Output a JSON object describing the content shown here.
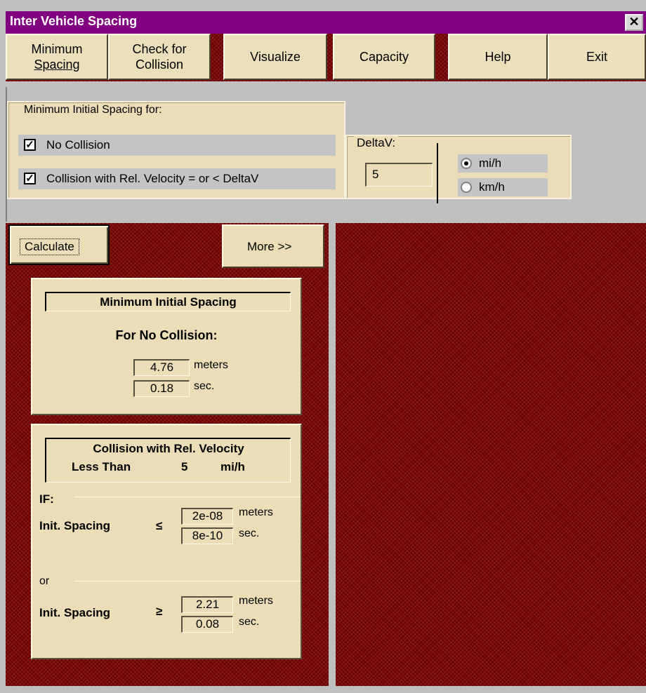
{
  "window": {
    "title": "Inter Vehicle Spacing",
    "close_glyph": "✕"
  },
  "toolbar": {
    "min_spacing": {
      "line1": "Minimum",
      "line2": "Spacing"
    },
    "check_collision": {
      "line1": "Check for",
      "line2": "Collision"
    },
    "visualize": "Visualize",
    "capacity": "Capacity",
    "help": "Help",
    "exit": "Exit"
  },
  "options": {
    "group_label": "Minimum Initial Spacing for:",
    "no_collision": {
      "label": "No Collision",
      "checked": true
    },
    "collision_delta": {
      "label": "Collision with Rel. Velocity = or < DeltaV",
      "checked": true
    },
    "deltav": {
      "label": "DeltaV:",
      "value": "5"
    },
    "units": {
      "mih": "mi/h",
      "kmh": "km/h",
      "selected": "mi/h"
    }
  },
  "actions": {
    "calculate": "Calculate",
    "more": "More >>"
  },
  "results": {
    "no_collision": {
      "title": "Minimum Initial Spacing",
      "subtitle": "For No Collision:",
      "meters_value": "4.76",
      "meters_unit": "meters",
      "sec_value": "0.18",
      "sec_unit": "sec."
    },
    "collision": {
      "title_line1": "Collision with Rel. Velocity",
      "less_than": "Less Than",
      "speed": "5",
      "speed_unit": "mi/h",
      "if_label": "IF:",
      "or_label": "or",
      "le_label": "Init. Spacing",
      "le_symbol": "≤",
      "le_meters": "2e-08",
      "le_sec": "8e-10",
      "ge_label": "Init. Spacing",
      "ge_symbol": "≥",
      "ge_meters": "2.21",
      "ge_sec": "0.08",
      "meters_unit": "meters",
      "sec_unit": "sec."
    }
  },
  "colors": {
    "title_bar": "#800080",
    "panel_beige": "#ecdcb8",
    "pattern_red": "#6e0000",
    "window_gray": "#c0c0c0"
  }
}
